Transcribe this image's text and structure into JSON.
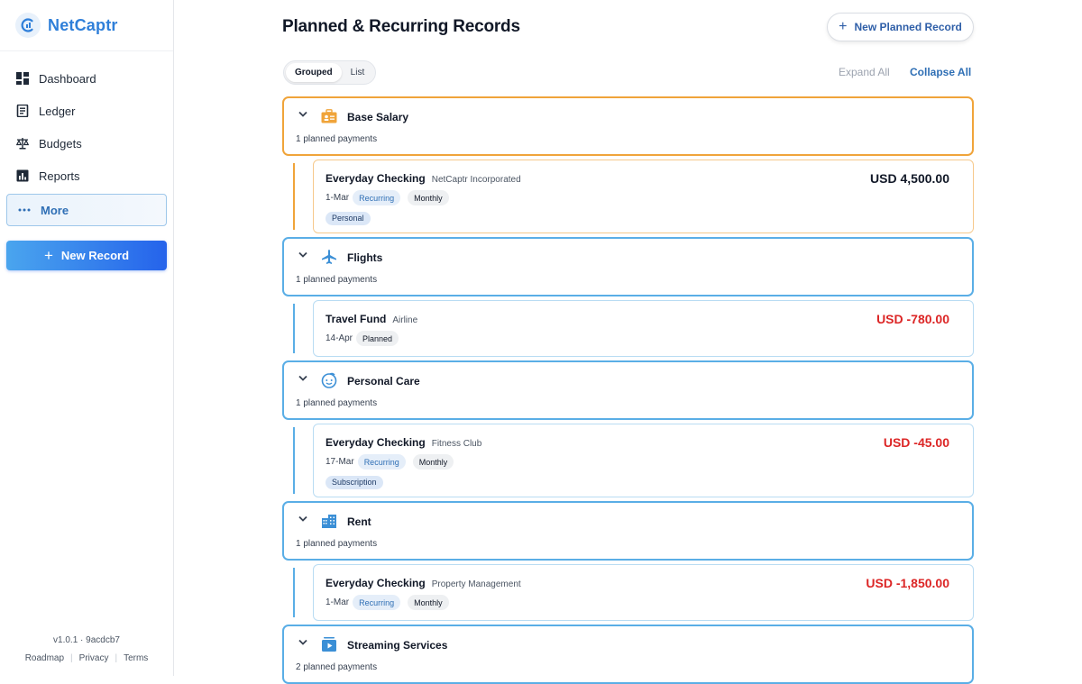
{
  "app": {
    "name": "NetCaptr"
  },
  "sidebar": {
    "items": [
      {
        "label": "Dashboard",
        "icon": "dashboard-icon"
      },
      {
        "label": "Ledger",
        "icon": "ledger-icon"
      },
      {
        "label": "Budgets",
        "icon": "scale-icon"
      },
      {
        "label": "Reports",
        "icon": "reports-icon"
      }
    ],
    "more_label": "More",
    "new_record_label": "New Record",
    "version": "v1.0.1 · 9acdcb7",
    "footer_links": [
      "Roadmap",
      "Privacy",
      "Terms"
    ]
  },
  "main": {
    "title": "Planned & Recurring Records",
    "new_planned_label": "New Planned Record",
    "view_options": [
      "Grouped",
      "List"
    ],
    "active_view": "Grouped",
    "expand_all_label": "Expand All",
    "collapse_all_label": "Collapse All",
    "groups": [
      {
        "name": "Base Salary",
        "count_label": "1 planned payments",
        "icon": "briefcase-icon",
        "accent": "#f0a43a",
        "records": [
          {
            "account": "Everyday Checking",
            "payee": "NetCaptr Incorporated",
            "date": "1-Mar",
            "status": "Recurring",
            "frequency": "Monthly",
            "tag": "Personal",
            "amount": "USD 4,500.00"
          }
        ]
      },
      {
        "name": "Flights",
        "count_label": "1 planned payments",
        "icon": "airplane-icon",
        "accent": "#5aaee6",
        "records": [
          {
            "account": "Travel Fund",
            "payee": "Airline",
            "date": "14-Apr",
            "status": "Planned",
            "amount": "USD -780.00"
          }
        ]
      },
      {
        "name": "Personal Care",
        "count_label": "1 planned payments",
        "icon": "face-icon",
        "accent": "#5aaee6",
        "records": [
          {
            "account": "Everyday Checking",
            "payee": "Fitness Club",
            "date": "17-Mar",
            "status": "Recurring",
            "frequency": "Monthly",
            "tag": "Subscription",
            "amount": "USD -45.00"
          }
        ]
      },
      {
        "name": "Rent",
        "count_label": "1 planned payments",
        "icon": "building-icon",
        "accent": "#5aaee6",
        "records": [
          {
            "account": "Everyday Checking",
            "payee": "Property Management",
            "date": "1-Mar",
            "status": "Recurring",
            "frequency": "Monthly",
            "amount": "USD -1,850.00"
          }
        ]
      },
      {
        "name": "Streaming Services",
        "count_label": "2 planned payments",
        "icon": "play-box-icon",
        "accent": "#5aaee6"
      }
    ]
  }
}
